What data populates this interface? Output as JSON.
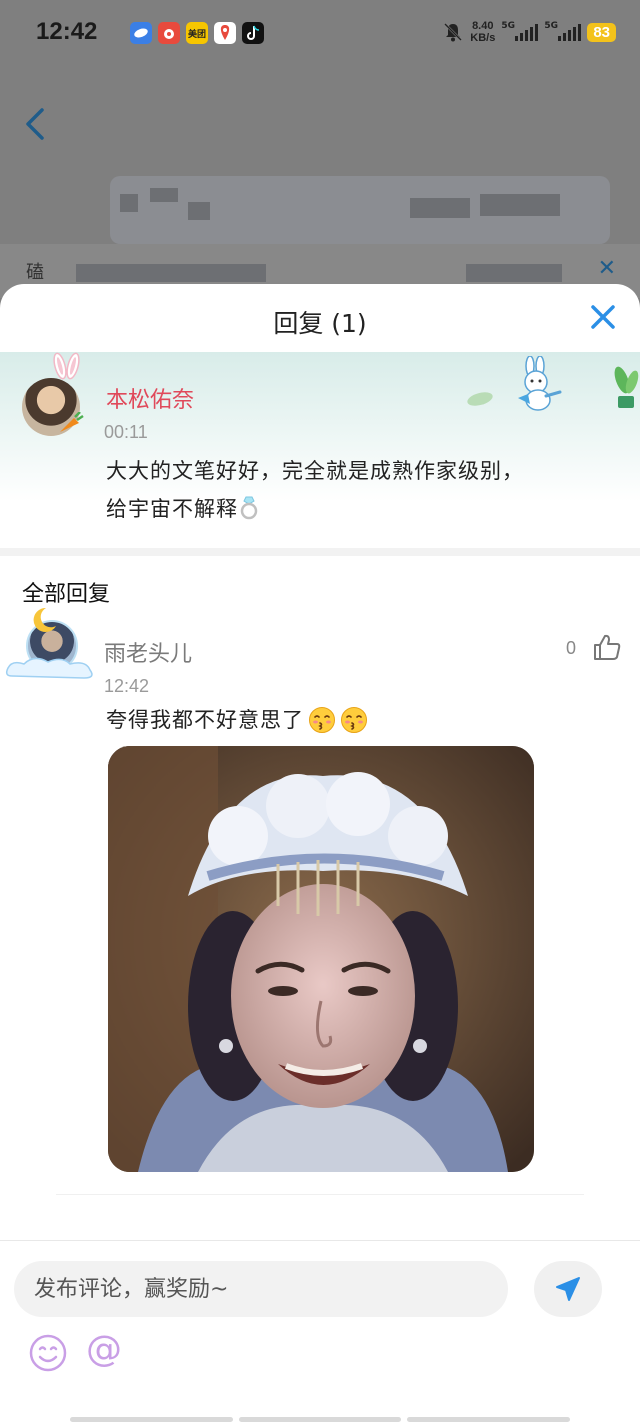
{
  "status_bar": {
    "time": "12:42",
    "apps": [
      {
        "icon": "blue-app-icon",
        "label": "",
        "color": "#3b7fe6"
      },
      {
        "icon": "red-app-icon",
        "label": "",
        "color": "#e84a3d"
      },
      {
        "icon": "meituan-icon",
        "label": "美团",
        "color": "#f7c600"
      },
      {
        "icon": "map-app-icon",
        "label": "",
        "color": "#ffffff"
      },
      {
        "icon": "tiktok-icon",
        "label": "",
        "color": "#111111"
      }
    ],
    "net_speed_value": "8.40",
    "net_speed_unit": "KB/s",
    "signal1_label": "5G",
    "signal2_label": "5G",
    "battery": "83"
  },
  "background_page": {
    "strip_label": "磕"
  },
  "sheet": {
    "title": "回复 (1)",
    "close_icon": "close-x-icon"
  },
  "parent_comment": {
    "author": "本松佑奈",
    "time": "00:11",
    "text_line1": "大大的文笔好好，完全就是成熟作家级别，",
    "text_line2": "给宇宙不解释",
    "trailing_emoji": "ring-emoji-icon",
    "author_color": "#e0495a"
  },
  "replies_section": {
    "title": "全部回复"
  },
  "reply": {
    "author": "雨老头儿",
    "time": "12:42",
    "like_count": "0",
    "text": "夸得我都不好意思了",
    "emojis": [
      "kissing-face-icon",
      "kissing-face-icon"
    ],
    "image": "meme-photo"
  },
  "input_bar": {
    "placeholder": "发布评论，赢奖励~",
    "send_icon": "send-arrow-icon",
    "emoji_icon": "smiley-icon",
    "at_label": "@",
    "accent": "#2b8fe6"
  }
}
